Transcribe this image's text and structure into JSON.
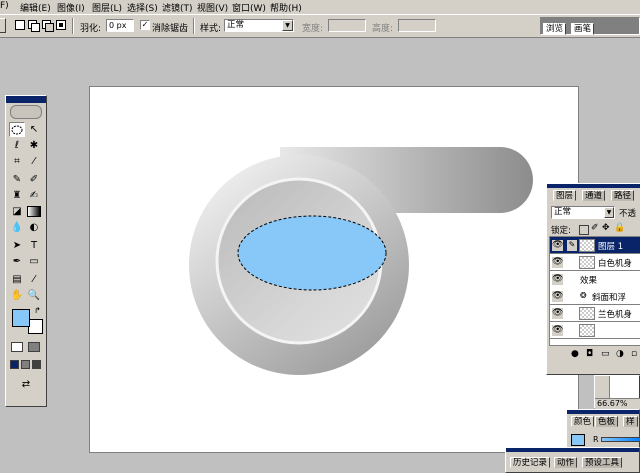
{
  "menu": {
    "items": [
      "F)",
      "编辑(E)",
      "图像(I)",
      "图层(L)",
      "选择(S)",
      "滤镜(T)",
      "视图(V)",
      "窗口(W)",
      "帮助(H)"
    ]
  },
  "options_bar": {
    "feather_label": "羽化:",
    "feather_value": "0 px",
    "antialias_label": "消除锯齿",
    "antialias_check": "✓",
    "style_label": "样式:",
    "style_value": "正常",
    "width_label": "宽度:",
    "height_label": "高度:",
    "palette_tab_1": "浏览",
    "palette_tab_2": "画笔"
  },
  "toolbox": {
    "foreground_color": "#88c8f8",
    "background_color": "#ffffff"
  },
  "artwork": {
    "lens_color": "#88c8f8"
  },
  "layers_panel": {
    "tabs": [
      "图层",
      "通道",
      "路径"
    ],
    "blend_mode": "正常",
    "opacity_label": "不透",
    "lock_label": "锁定:",
    "layers": [
      {
        "name": "图层 1",
        "selected": true
      },
      {
        "name": "白色机身",
        "selected": false
      }
    ],
    "effects_label": "效果",
    "effect_name": "斜面和浮",
    "layer_3": "兰色机身"
  },
  "navigator": {
    "zoom": "66.67%"
  },
  "color_panel": {
    "tabs": [
      "颜色",
      "色板",
      "样"
    ],
    "channel_label": "R"
  },
  "history_panel": {
    "tabs": [
      "历史记录",
      "动作",
      "预设工具"
    ]
  }
}
